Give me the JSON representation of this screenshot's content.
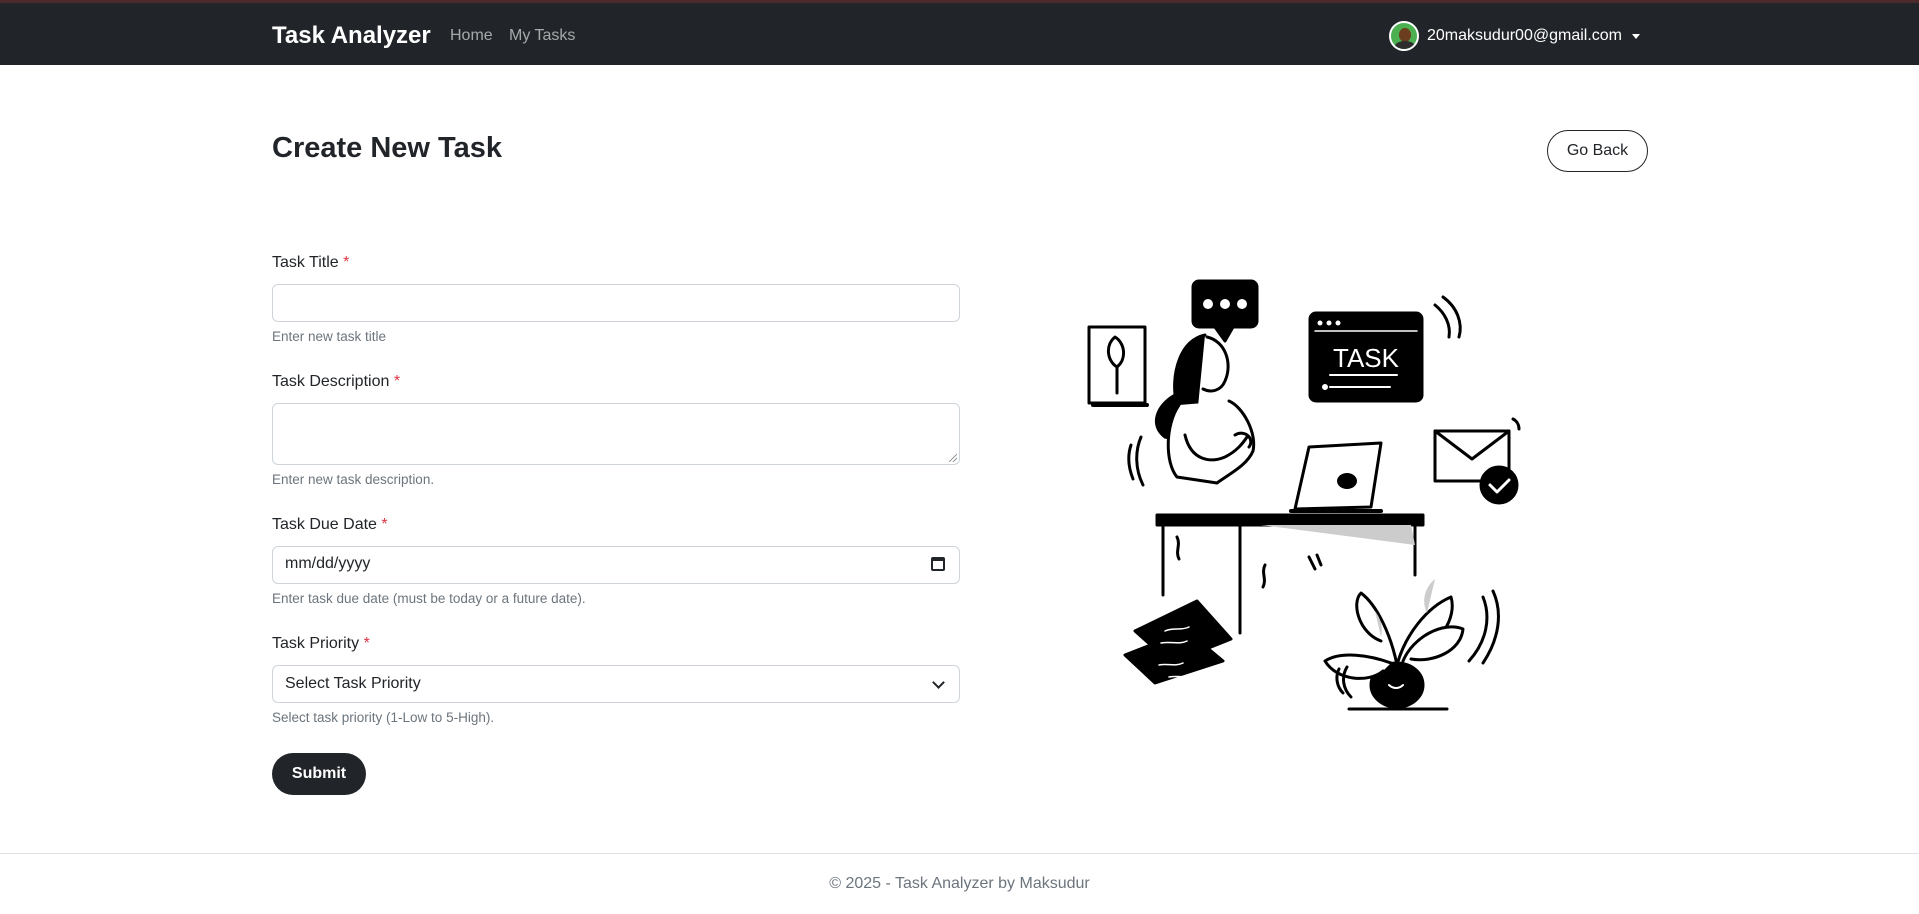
{
  "navbar": {
    "brand": "Task Analyzer",
    "links": [
      {
        "label": "Home"
      },
      {
        "label": "My Tasks"
      }
    ],
    "user": {
      "email": "20maksudur00@gmail.com"
    }
  },
  "page": {
    "title": "Create New Task",
    "back_label": "Go Back"
  },
  "form": {
    "title": {
      "label": "Task Title",
      "required_mark": "*",
      "help": "Enter new task title",
      "value": ""
    },
    "description": {
      "label": "Task Description",
      "required_mark": "*",
      "help": "Enter new task description.",
      "value": ""
    },
    "due_date": {
      "label": "Task Due Date",
      "required_mark": "*",
      "placeholder": "mm/dd/yyyy",
      "help": "Enter task due date (must be today or a future date)."
    },
    "priority": {
      "label": "Task Priority",
      "required_mark": "*",
      "selected": "Select Task Priority",
      "help": "Select task priority (1-Low to 5-High)."
    },
    "submit_label": "Submit"
  },
  "illustration": {
    "screen_text": "TASK"
  },
  "footer": {
    "text": "© 2025 - Task Analyzer by Maksudur"
  }
}
